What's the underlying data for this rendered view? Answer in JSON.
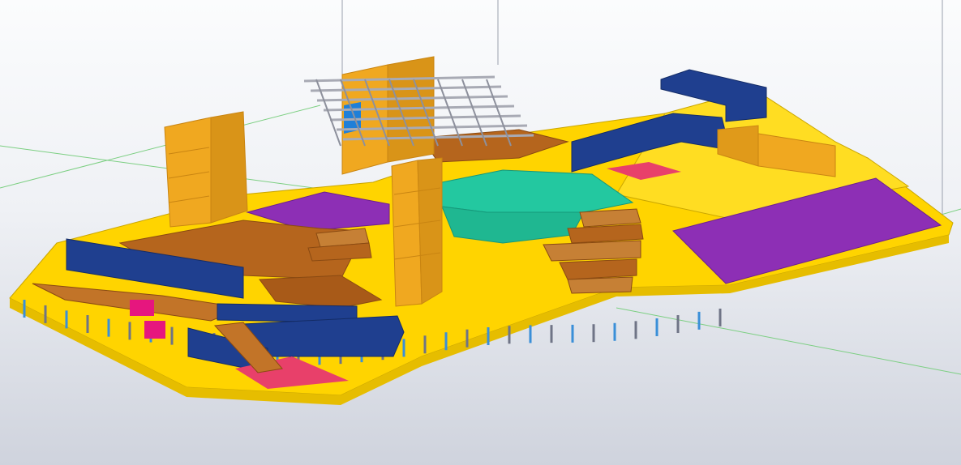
{
  "viewport": {
    "background_top": "#fbfcfd",
    "background_bottom": "#cfd3dd",
    "grid_line_color": "#7ccf82"
  },
  "model": {
    "name": "structural-bim-building-model",
    "view": "isometric",
    "palette": {
      "deck_yellow": "#ffd400",
      "deck_yellow_dark": "#e6bd00",
      "core_orange": "#f0a820",
      "core_orange_dark": "#c98512",
      "timber_brown": "#b5651d",
      "timber_brown_dark": "#8a4a12",
      "facade_blue": "#1f3f8f",
      "facade_blue_dark": "#142c66",
      "roof_purple": "#8d2fb5",
      "slab_teal": "#23c8a0",
      "accent_magenta": "#e6167e",
      "accent_pink": "#e8406a",
      "steel_grey": "#a8aab4",
      "column_blue": "#3a8fd8",
      "column_grey": "#6f7486"
    }
  }
}
